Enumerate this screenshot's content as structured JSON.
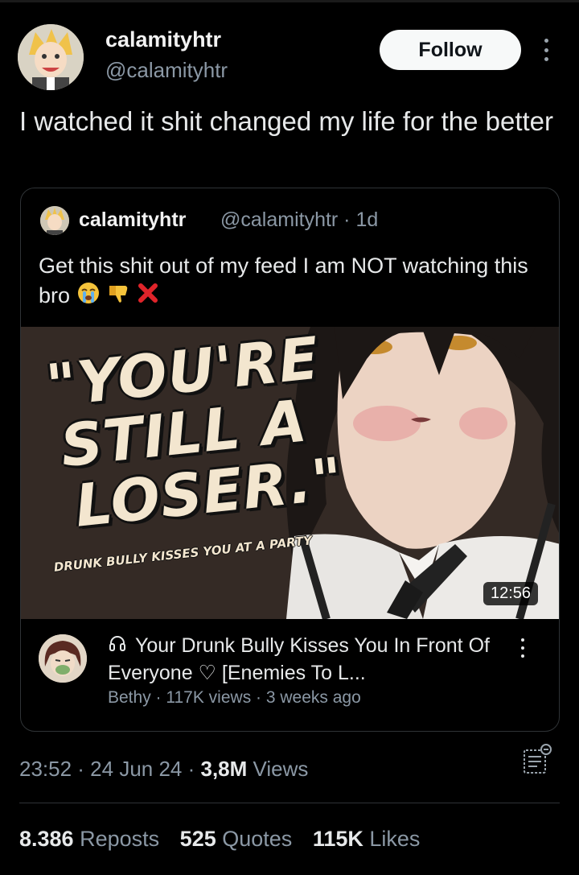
{
  "user": {
    "name": "calamityhtr",
    "handle": "@calamityhtr",
    "follow_label": "Follow"
  },
  "tweet": {
    "text": "I watched it shit changed my life for the better"
  },
  "quoted": {
    "name": "calamityhtr",
    "meta": "@calamityhtr · 1d",
    "text": "Get this shit out of my feed I am NOT watching this bro",
    "emojis": [
      "crying-face-icon",
      "thumbs-down-icon",
      "red-x-icon"
    ]
  },
  "video": {
    "thumbnail_title_lines": [
      "\"YOU'RE",
      "STILL A",
      "LOSER.\""
    ],
    "thumbnail_subtitle": "DRUNK BULLY KISSES YOU AT A PARTY",
    "duration": "12:56",
    "title": "Your Drunk Bully Kisses You In Front Of Everyone ♡ [Enemies To L...",
    "meta": "Bethy · 117K views · 3 weeks ago"
  },
  "footer": {
    "time": "23:52 · 24 Jun 24 · ",
    "views_count": "3,8M",
    "views_label": " Views"
  },
  "stats": {
    "reposts_count": "8.386",
    "reposts_label": "Reposts",
    "quotes_count": "525",
    "quotes_label": "Quotes",
    "likes_count": "115K",
    "likes_label": "Likes"
  },
  "colors": {
    "background": "#000000",
    "text": "#e7e9ea",
    "secondary": "#8b98a5",
    "border": "#2f3336"
  }
}
